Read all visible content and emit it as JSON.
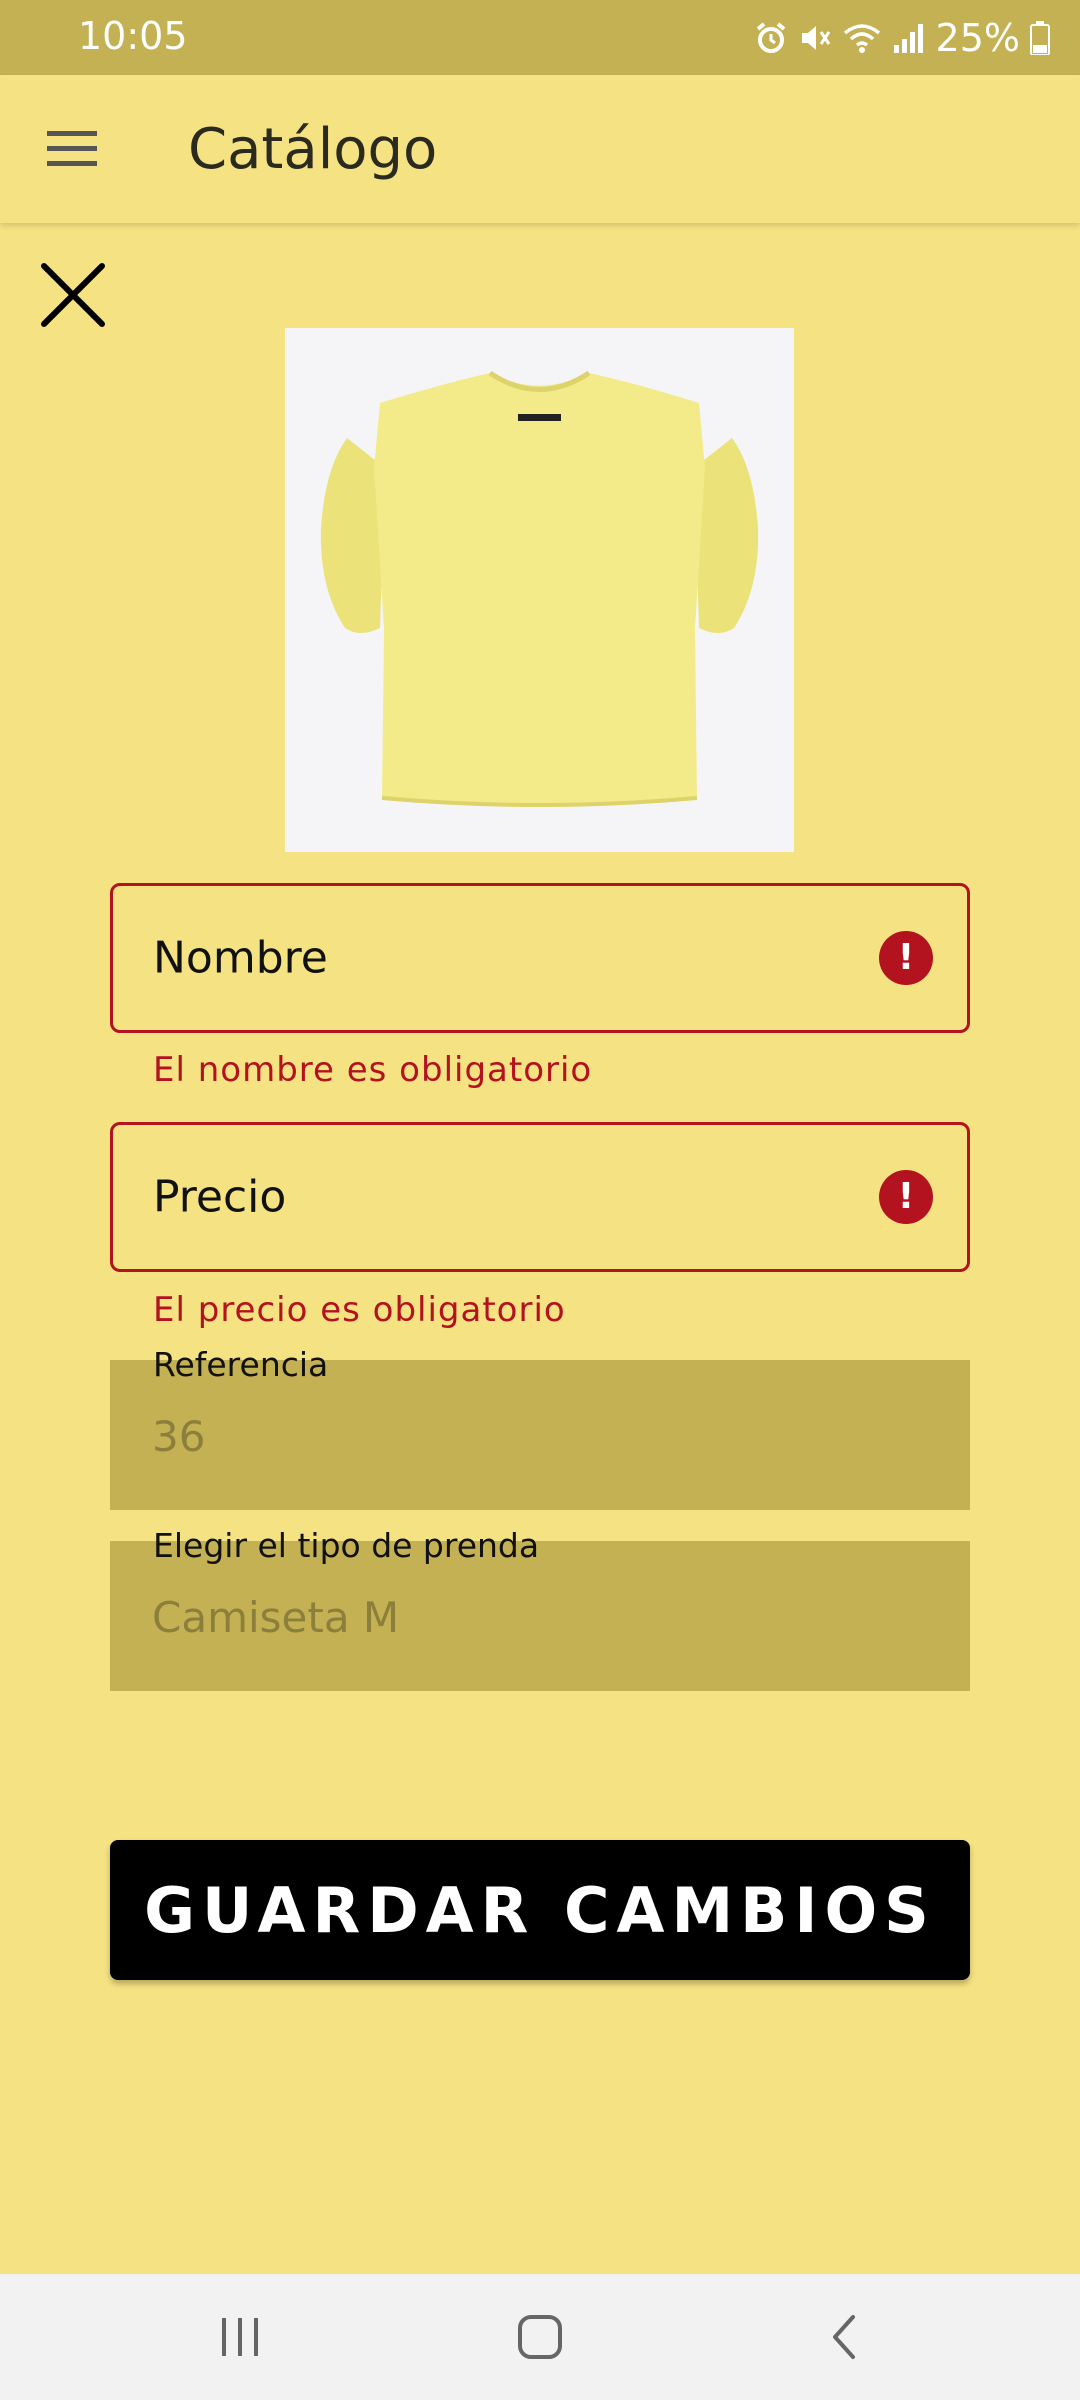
{
  "status_bar": {
    "time": "10:05",
    "battery": "25%",
    "icons": [
      "alarm-icon",
      "mute-icon",
      "wifi-icon",
      "signal-icon",
      "battery-icon"
    ]
  },
  "app_bar": {
    "title": "Catálogo",
    "menu_icon": "menu-icon"
  },
  "close_icon": "close-icon",
  "product_image": {
    "description_icon": "tshirt-image",
    "color": "#F3EB8A"
  },
  "form": {
    "name": {
      "label": "Nombre",
      "error": "El nombre es obligatorio"
    },
    "price": {
      "label": "Precio",
      "error": "El precio es obligatorio"
    },
    "reference": {
      "label": "Referencia",
      "value": "36"
    },
    "garment_type": {
      "label": "Elegir el tipo de prenda",
      "value": "Camiseta M"
    }
  },
  "save_button": {
    "label": "GUARDAR CAMBIOS"
  },
  "nav_bar": {
    "icons": [
      "recents-icon",
      "home-icon",
      "back-icon"
    ]
  },
  "colors": {
    "background": "#F5E282",
    "status_bar": "#C4B153",
    "error": "#B3121F",
    "disabled_field": "#C4B153",
    "button": "#000000"
  }
}
